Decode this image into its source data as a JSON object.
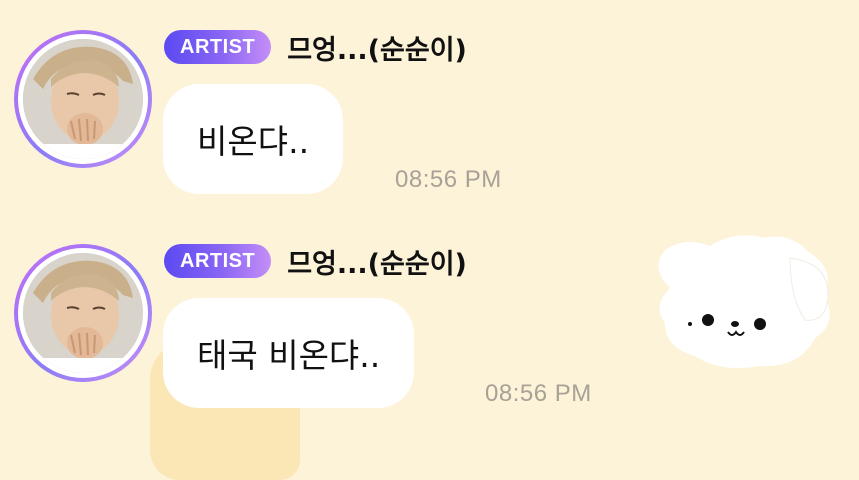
{
  "messages": [
    {
      "badge": "ARTIST",
      "sender": "므엉...(순순이)",
      "text": "비온댜..",
      "time": "08:56 PM"
    },
    {
      "badge": "ARTIST",
      "sender": "므엉...(순순이)",
      "text": "태국 비온댜..",
      "time": "08:56 PM"
    }
  ],
  "colors": {
    "background": "#fdf3d9",
    "badge_start": "#5b49f2",
    "badge_end": "#c58ef7",
    "bubble": "#ffffff",
    "time": "#a8a196"
  },
  "icons": {
    "sticker": "white-puppy-sticker"
  }
}
